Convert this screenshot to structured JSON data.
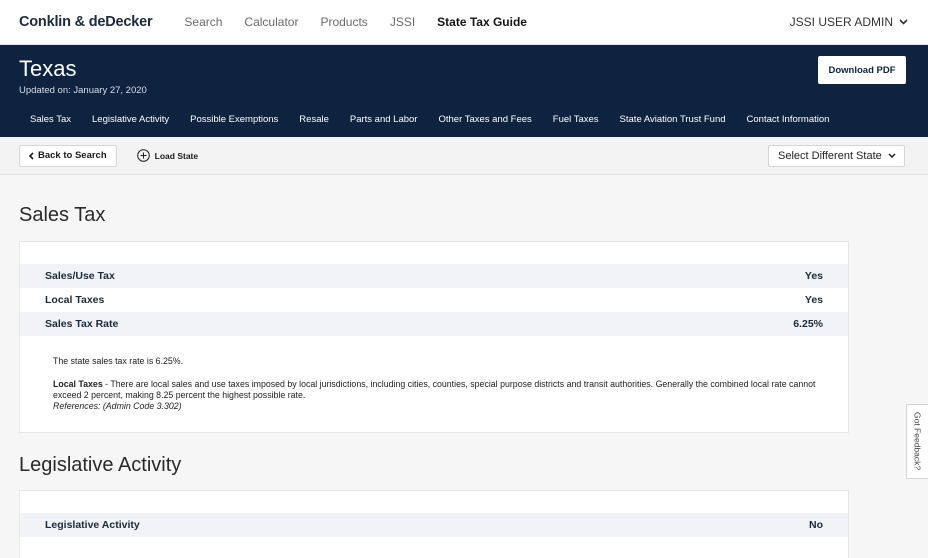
{
  "topnav": {
    "logo": "Conklin & deDecker",
    "links": [
      "Search",
      "Calculator",
      "Products",
      "JSSI",
      "State Tax Guide"
    ],
    "active_link": "State Tax Guide",
    "user": "JSSI USER ADMIN"
  },
  "header": {
    "title": "Texas",
    "updated": "Updated on: January 27, 2020",
    "download_label": "Download PDF",
    "tabs": [
      "Sales Tax",
      "Legislative Activity",
      "Possible Exemptions",
      "Resale",
      "Parts and Labor",
      "Other Taxes and Fees",
      "Fuel Taxes",
      "State Aviation Trust Fund",
      "Contact Information"
    ]
  },
  "toolbar": {
    "back_label": "Back to Search",
    "load_label": "Load State",
    "select_label": "Select Different State"
  },
  "sales_tax": {
    "heading": "Sales Tax",
    "rows": [
      {
        "label": "Sales/Use Tax",
        "value": "Yes"
      },
      {
        "label": "Local Taxes",
        "value": "Yes"
      },
      {
        "label": "Sales Tax Rate",
        "value": "6.25%"
      }
    ],
    "rate_text": "The state sales tax rate is 6.25%.",
    "local_label": "Local Taxes",
    "local_text": " - There are local sales and use taxes imposed by local jurisdictions, including cities, counties, special purpose districts and transit authorities. Generally the combined local rate cannot exceed 2 percent, making 8.25 percent the highest possible rate.",
    "references": "References: (Admin Code 3.302)"
  },
  "legislative": {
    "heading": "Legislative Activity",
    "rows": [
      {
        "label": "Legislative Activity",
        "value": "No"
      }
    ]
  },
  "feedback_label": "Got Feedback?"
}
